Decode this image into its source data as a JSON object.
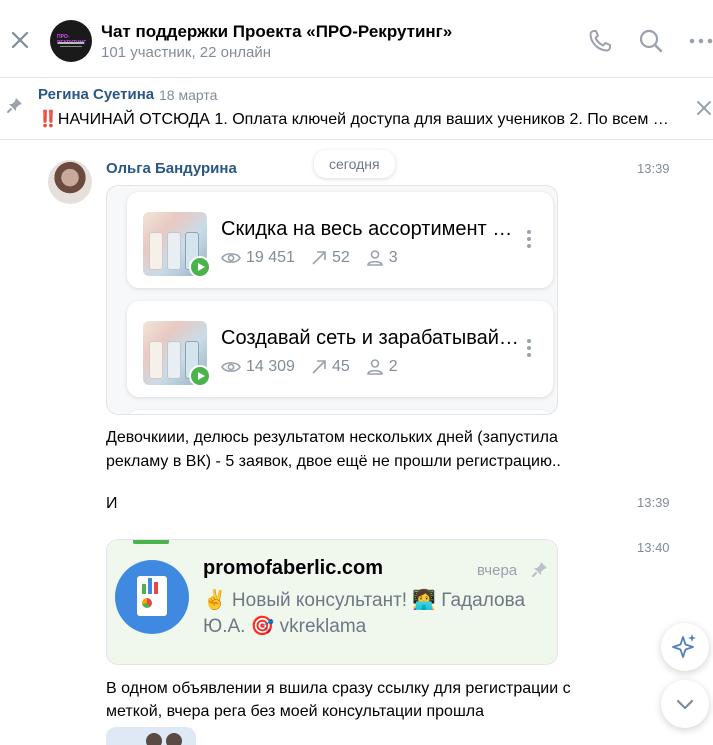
{
  "header": {
    "title": "Чат поддержки Проекта «ПРО-Рекрутинг»",
    "subtitle": "101 участник, 22 онлайн",
    "logo_text": "ПРО-РЕКРУТИНГ"
  },
  "pinned": {
    "author": "Регина Суетина",
    "date": "18 марта",
    "text": "‼️НАЧИНАЙ ОТСЮДА 1. Оплата ключей доступа для ваших учеников 2. По всем …"
  },
  "date_chip": "сегодня",
  "messages": [
    {
      "author": "Ольга Бандурина",
      "time": "13:39",
      "cards": [
        {
          "title": "Скидка на весь ассортимент о...",
          "views": "19 451",
          "shares": "52",
          "members": "3"
        },
        {
          "title": "Создавай сеть и зарабатывай ...",
          "views": "14 309",
          "shares": "45",
          "members": "2"
        }
      ],
      "text_line1": "Девочкиии, делюсь результатом нескольких дней (запустила",
      "text_line2": "рекламу в ВК) - 5 заявок, двое ещё не прошли регистрацию.."
    },
    {
      "time": "13:39",
      "text": "И"
    },
    {
      "time": "13:40",
      "link": {
        "domain": "promofaberlic.com",
        "date": "вчера",
        "desc_line1": "✌️ Новый консультант! 👩‍💻 Гадалова",
        "desc_line2": "Ю.А. 🎯 vkreklama"
      },
      "text_line1": "В одном объявлении я вшила сразу ссылку для регистрации с",
      "text_line2": "меткой, вчера рега без моей консультации прошла"
    }
  ],
  "colors": {
    "accent_blue": "#2a5885",
    "green": "#4bb34b",
    "secondary_text": "#818c99"
  }
}
